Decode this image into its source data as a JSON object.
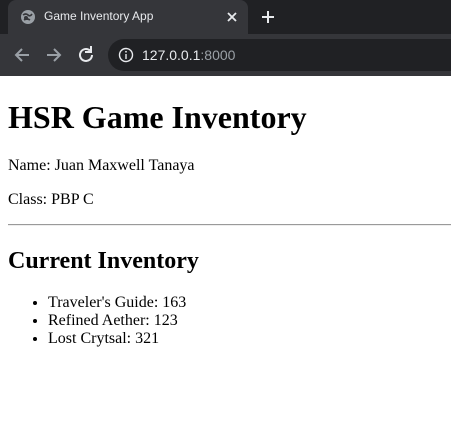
{
  "browser": {
    "tab_title": "Game Inventory App",
    "url_host": "127.0.0.1",
    "url_port": ":8000",
    "icons": {
      "favicon": "globe-icon",
      "tab_close": "close-icon",
      "new_tab": "plus-icon",
      "back": "arrow-left-icon",
      "forward": "arrow-right-icon",
      "reload": "reload-icon",
      "site_info": "info-icon"
    },
    "colors": {
      "tabstrip": "#202124",
      "active_tab": "#35363a",
      "omnibox": "#202124"
    }
  },
  "page": {
    "title": "HSR Game Inventory",
    "name_line": "Name: Juan Maxwell Tanaya",
    "class_line": "Class: PBP C",
    "inventory_heading": "Current Inventory",
    "items": [
      {
        "text": "Traveler's Guide: 163"
      },
      {
        "text": "Refined Aether: 123"
      },
      {
        "text": "Lost Crytsal: 321"
      }
    ]
  }
}
